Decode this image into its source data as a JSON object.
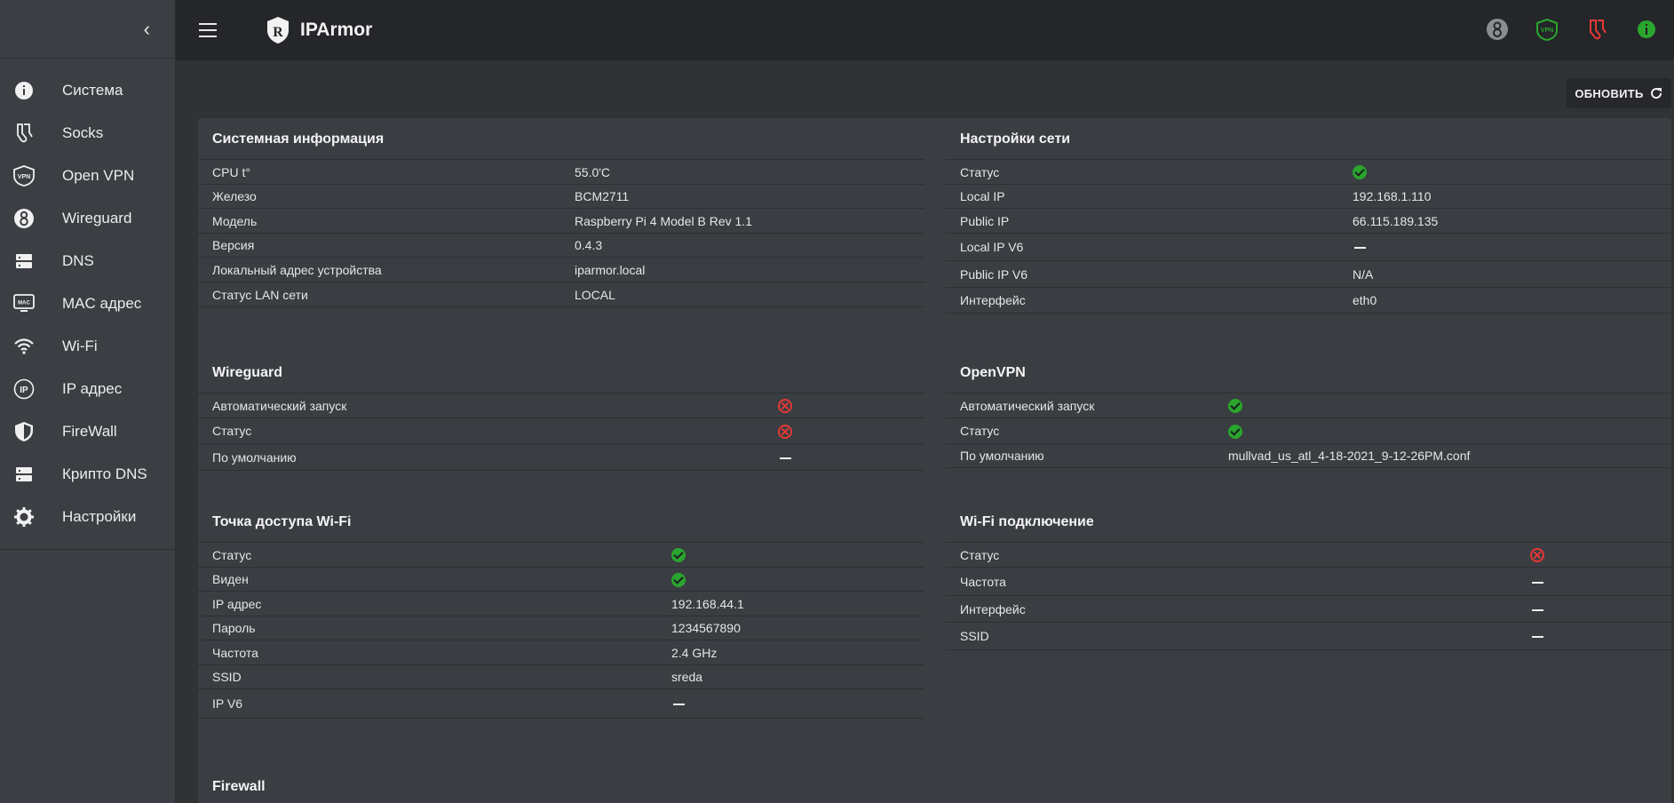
{
  "app": {
    "name": "IPArmor",
    "refresh_label": "ОБНОВИТЬ"
  },
  "sidebar": {
    "items": [
      {
        "label": "Система",
        "icon": "info-icon"
      },
      {
        "label": "Socks",
        "icon": "socks-icon"
      },
      {
        "label": "Open VPN",
        "icon": "vpn-icon"
      },
      {
        "label": "Wireguard",
        "icon": "wireguard-icon"
      },
      {
        "label": "DNS",
        "icon": "dns-icon"
      },
      {
        "label": "MAC адрес",
        "icon": "mac-icon"
      },
      {
        "label": "Wi-Fi",
        "icon": "wifi-icon"
      },
      {
        "label": "IP адрес",
        "icon": "ip-icon"
      },
      {
        "label": "FireWall",
        "icon": "shield-icon"
      },
      {
        "label": "Крипто DNS",
        "icon": "dns-icon"
      },
      {
        "label": "Настройки",
        "icon": "gear-icon"
      }
    ]
  },
  "topbar": {
    "vpn_badge": "VPN"
  },
  "system_info": {
    "title": "Системная информация",
    "rows": [
      {
        "key": "CPU t°",
        "value": "55.0'C"
      },
      {
        "key": "Железо",
        "value": "BCM2711"
      },
      {
        "key": "Модель",
        "value": "Raspberry Pi 4 Model B Rev 1.1"
      },
      {
        "key": "Версия",
        "value": "0.4.3"
      },
      {
        "key": "Локальный адрес устройства",
        "value": "iparmor.local"
      },
      {
        "key": "Статус LAN сети",
        "value": "LOCAL"
      }
    ]
  },
  "network": {
    "title": "Настройки сети",
    "rows": [
      {
        "key": "Статус",
        "status": "ok"
      },
      {
        "key": "Local IP",
        "value": "192.168.1.110"
      },
      {
        "key": "Public IP",
        "value": "66.115.189.135"
      },
      {
        "key": "Local IP V6",
        "status": "none"
      },
      {
        "key": "Public IP V6",
        "value": "N/A"
      },
      {
        "key": "Интерфейс",
        "value": "eth0"
      }
    ]
  },
  "wireguard": {
    "title": "Wireguard",
    "rows": [
      {
        "key": "Автоматический запуск",
        "status": "error"
      },
      {
        "key": "Статус",
        "status": "error"
      },
      {
        "key": "По умолчанию",
        "status": "none"
      }
    ]
  },
  "openvpn": {
    "title": "OpenVPN",
    "rows": [
      {
        "key": "Автоматический запуск",
        "status": "ok"
      },
      {
        "key": "Статус",
        "status": "ok"
      },
      {
        "key": "По умолчанию",
        "value": "mullvad_us_atl_4-18-2021_9-12-26PM.conf"
      }
    ]
  },
  "wifi_ap": {
    "title": "Точка доступа Wi-Fi",
    "rows": [
      {
        "key": "Статус",
        "status": "ok"
      },
      {
        "key": "Виден",
        "status": "ok"
      },
      {
        "key": "IP адрес",
        "value": "192.168.44.1"
      },
      {
        "key": "Пароль",
        "value": "1234567890"
      },
      {
        "key": "Частота",
        "value": "2.4 GHz"
      },
      {
        "key": "SSID",
        "value": "sreda"
      },
      {
        "key": "IP V6",
        "status": "none"
      }
    ]
  },
  "wifi_client": {
    "title": "Wi-Fi подключение",
    "rows": [
      {
        "key": "Статус",
        "status": "error"
      },
      {
        "key": "Частота",
        "status": "none"
      },
      {
        "key": "Интерфейс",
        "status": "none"
      },
      {
        "key": "SSID",
        "status": "none"
      }
    ]
  },
  "firewall": {
    "title": "Firewall"
  },
  "colors": {
    "ok": "#2aa52e",
    "error": "#e53935",
    "background": "#303236",
    "card": "#3a3d41"
  }
}
